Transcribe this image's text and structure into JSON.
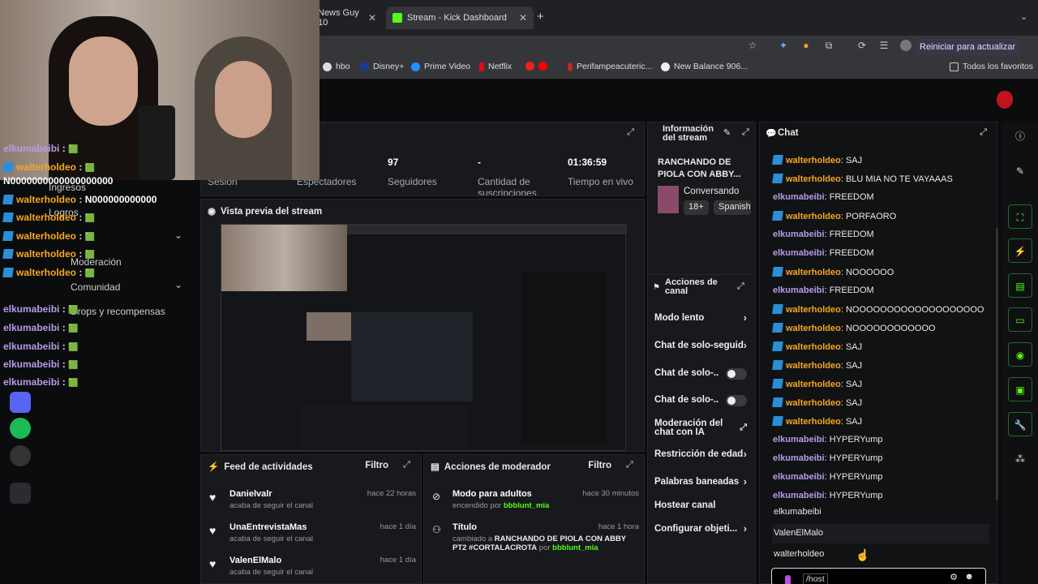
{
  "browser": {
    "tabs": [
      {
        "label": "News Guy 10"
      },
      {
        "label": "Stream - Kick Dashboard"
      }
    ],
    "add_tab": "+",
    "update_button": "Reiniciar para actualizar",
    "bookmarks": [
      {
        "label": "hbo"
      },
      {
        "label": "Disney+"
      },
      {
        "label": "Prime Video"
      },
      {
        "label": "Netflix"
      },
      {
        "label": "Perifampeacuteric..."
      },
      {
        "label": "New Balance 906..."
      }
    ],
    "all_bookmarks": "Todos los favoritos"
  },
  "stats": [
    {
      "value": "",
      "label": "Sesión"
    },
    {
      "value": "",
      "label": "Espectadores"
    },
    {
      "value": "97",
      "label": "Seguidores"
    },
    {
      "value": "-",
      "label": "Cantidad de suscripciones"
    },
    {
      "value": "01:36:59",
      "label": "Tiempo en vivo"
    }
  ],
  "preview": {
    "title": "Vista previa del stream"
  },
  "feed": {
    "title": "Feed de actividades",
    "filter": "Filtro",
    "items": [
      {
        "name": "Danielvalr",
        "sub": "acaba de seguir el canal",
        "time": "hace 22 horas"
      },
      {
        "name": "UnaEntrevistaMas",
        "sub": "acaba de seguir el canal",
        "time": "hace 1 día"
      },
      {
        "name": "ValenElMalo",
        "sub": "acaba de seguir el canal",
        "time": "hace 1 día"
      }
    ]
  },
  "modactions": {
    "title": "Acciones de moderador",
    "filter": "Filtro",
    "items": [
      {
        "name": "Modo para adultos",
        "pre": "encendido por ",
        "user": "bbblunt_mia",
        "mid": "",
        "bold": "",
        "time": "hace 30 minutos"
      },
      {
        "name": "Título",
        "pre": "cambiado a ",
        "bold": "RANCHANDO DE PIOLA CON ABBY PT2 #CORTALACROTA",
        "mid": " por ",
        "user": "bbblunt_mia",
        "time": "hace 1 hora"
      }
    ]
  },
  "info": {
    "title": "Información del stream",
    "stream_title": "RANCHANDO DE PIOLA CON ABBY...",
    "category": "Conversando",
    "tags": [
      "18+",
      "Spanish"
    ]
  },
  "actions": {
    "title": "Acciones de canal",
    "items": [
      {
        "label": "Modo lento",
        "kind": "chevron"
      },
      {
        "label": "Chat de solo-seguid",
        "kind": "chevron"
      },
      {
        "label": "Chat de solo-...",
        "kind": "toggle"
      },
      {
        "label": "Chat de solo-...",
        "kind": "toggle"
      },
      {
        "label": "Moderación del chat con IA",
        "kind": "link"
      },
      {
        "label": "Restricción de edad",
        "kind": "chevron"
      },
      {
        "label": "Palabras baneadas",
        "kind": "chevron"
      },
      {
        "label": "Hostear canal",
        "kind": "none"
      },
      {
        "label": "Configurar objeti...",
        "kind": "chevron"
      }
    ]
  },
  "chat": {
    "title": "Chat",
    "messages": [
      {
        "user": "walterholdeo",
        "text": "SAJ",
        "badge": true
      },
      {
        "user": "walterholdeo",
        "text": "BLU MIA NO TE VAYAAAS",
        "badge": true
      },
      {
        "user": "elkumabeibi",
        "text": "FREEDOM",
        "badge": false
      },
      {
        "user": "walterholdeo",
        "text": "PORFAORO",
        "badge": true
      },
      {
        "user": "elkumabeibi",
        "text": "FREEDOM",
        "badge": false
      },
      {
        "user": "elkumabeibi",
        "text": "FREEDOM",
        "badge": false
      },
      {
        "user": "walterholdeo",
        "text": "NOOOOOO",
        "badge": true
      },
      {
        "user": "elkumabeibi",
        "text": "FREEDOM",
        "badge": false
      },
      {
        "user": "walterholdeo",
        "text": "NOOOOOOOOOOOOOOOOOOO",
        "badge": true
      },
      {
        "user": "walterholdeo",
        "text": "NOOOOOOOOOOOO",
        "badge": true
      },
      {
        "user": "walterholdeo",
        "text": "SAJ",
        "badge": true
      },
      {
        "user": "walterholdeo",
        "text": "SAJ",
        "badge": true
      },
      {
        "user": "walterholdeo",
        "text": "SAJ",
        "badge": true
      },
      {
        "user": "walterholdeo",
        "text": "SAJ",
        "badge": true
      },
      {
        "user": "walterholdeo",
        "text": "SAJ",
        "badge": true
      },
      {
        "user": "elkumabeibi",
        "text": "HYPERYump",
        "badge": false
      },
      {
        "user": "elkumabeibi",
        "text": "HYPERYump",
        "badge": false
      },
      {
        "user": "elkumabeibi",
        "text": "HYPERYump",
        "badge": false
      },
      {
        "user": "elkumabeibi",
        "text": "HYPERYump",
        "badge": false
      }
    ],
    "suggestions": [
      "elkumabeibi",
      "ValenElMalo",
      "walterholdeo"
    ],
    "input_value": "/host"
  },
  "overlay": {
    "lines": [
      {
        "user": "elkumabeibi",
        "text": "",
        "badge": false
      },
      {
        "user": "walterholdeo",
        "text": "",
        "badge": true
      },
      {
        "user": "",
        "text": "N0000000000000000000",
        "badge": false
      },
      {
        "user": "walterholdeo",
        "text": "N000000000000",
        "badge": true
      },
      {
        "user": "walterholdeo",
        "text": "",
        "badge": true
      },
      {
        "user": "walterholdeo",
        "text": "",
        "badge": true
      },
      {
        "user": "walterholdeo",
        "text": "",
        "badge": true
      },
      {
        "user": "walterholdeo",
        "text": "",
        "badge": true
      },
      {
        "user": "elkumabeibi",
        "text": "",
        "badge": false
      },
      {
        "user": "elkumabeibi",
        "text": "",
        "badge": false
      },
      {
        "user": "elkumabeibi",
        "text": "",
        "badge": false
      },
      {
        "user": "elkumabeibi",
        "text": "",
        "badge": false
      },
      {
        "user": "elkumabeibi",
        "text": "",
        "badge": false
      }
    ],
    "sidebar": [
      "Ingresos",
      "Logros",
      "Moderación",
      "Comunidad",
      "Drops y recompensas"
    ]
  },
  "colors": {
    "kick_green": "#53fc18",
    "username_orange": "#f5a623",
    "username_purple": "#b99ae6"
  }
}
